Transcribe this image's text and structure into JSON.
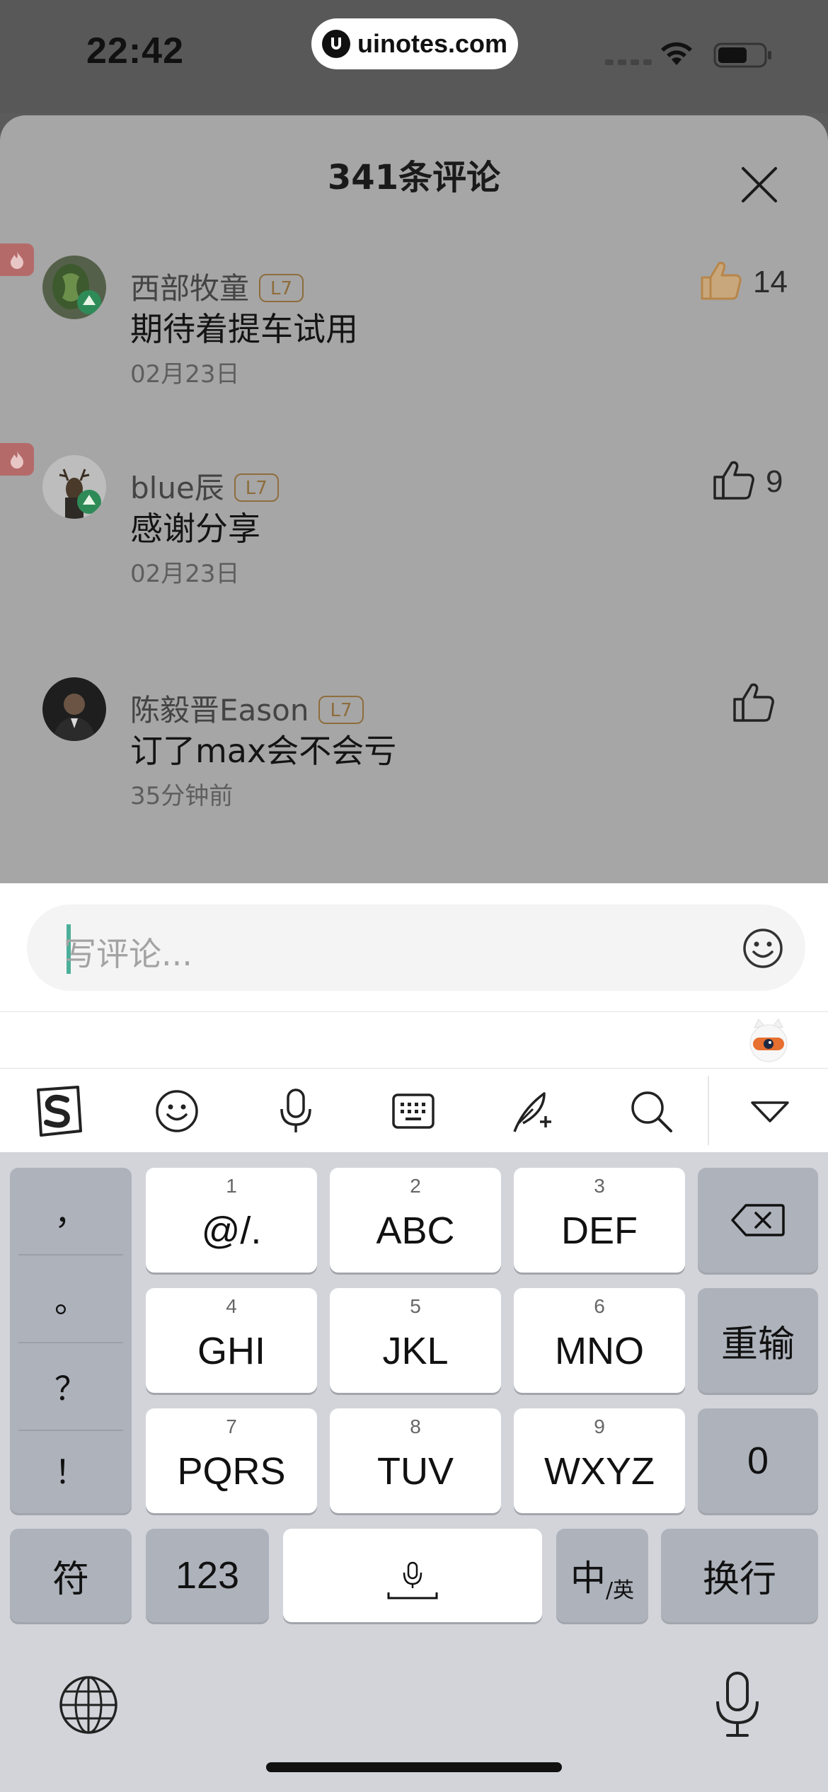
{
  "status_bar": {
    "time": "22:42",
    "url": "uinotes.com"
  },
  "comments_sheet": {
    "title": "341条评论",
    "comments": [
      {
        "username": "西部牧童",
        "level": "L7",
        "text": "期待着提车试用",
        "date": "02月23日",
        "likes": "14",
        "hot": true,
        "liked": true
      },
      {
        "username": "blue辰",
        "level": "L7",
        "text": "感谢分享",
        "date": "02月23日",
        "likes": "9",
        "hot": true,
        "liked": false
      },
      {
        "username": "陈毅晋Eason",
        "level": "L7",
        "text": "订了max会不会亏",
        "date": "35分钟前",
        "likes": "",
        "hot": false,
        "liked": false
      }
    ]
  },
  "input": {
    "placeholder": "写评论..."
  },
  "keyboard": {
    "toolbar_icons": [
      "sogou-logo-icon",
      "emoji-icon",
      "microphone-icon",
      "keyboard-icon",
      "handwriting-icon",
      "search-icon",
      "collapse-keyboard-icon"
    ],
    "punctuation": [
      "，",
      "。",
      "？",
      "！"
    ],
    "keys": [
      {
        "num": "1",
        "label": "@/."
      },
      {
        "num": "2",
        "label": "ABC"
      },
      {
        "num": "3",
        "label": "DEF"
      },
      {
        "num": "4",
        "label": "GHI"
      },
      {
        "num": "5",
        "label": "JKL"
      },
      {
        "num": "6",
        "label": "MNO"
      },
      {
        "num": "7",
        "label": "PQRS"
      },
      {
        "num": "8",
        "label": "TUV"
      },
      {
        "num": "9",
        "label": "WXYZ"
      }
    ],
    "reenter": "重输",
    "zero": "0",
    "symbols": "符",
    "numbers": "123",
    "lang_main": "中",
    "lang_sub": "/英",
    "newline": "换行"
  },
  "colors": {
    "overlay_sheet": "#a6a6a6",
    "hot_badge": "#b56a6a",
    "level_badge": "#8e6d3c",
    "liked_thumb": "#b8864a",
    "caret": "#4caf9a",
    "keyboard_bg": "#d2d4da"
  }
}
